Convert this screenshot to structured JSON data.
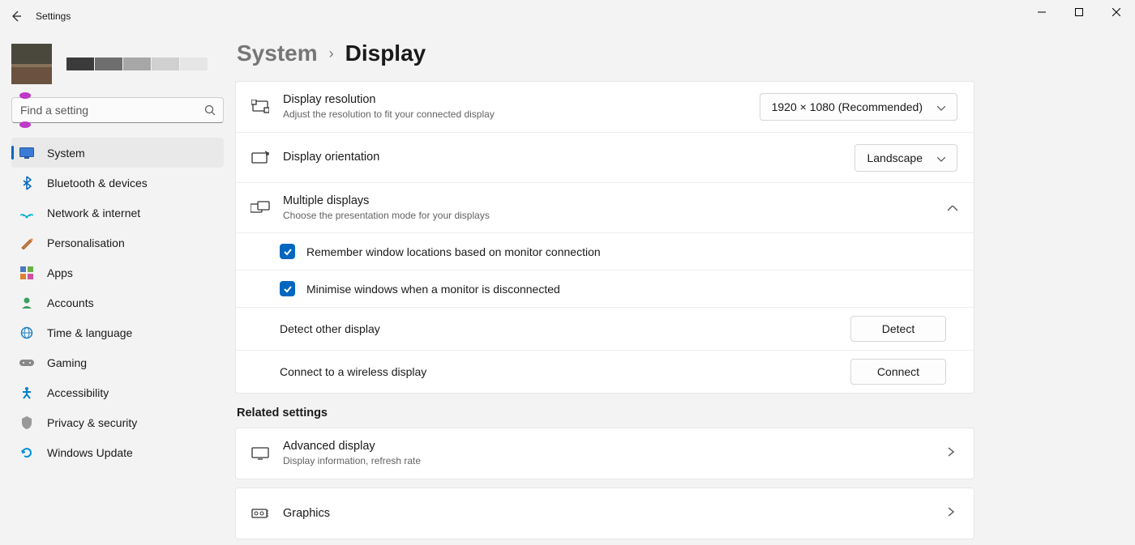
{
  "window": {
    "title": "Settings"
  },
  "search": {
    "placeholder": "Find a setting"
  },
  "nav": {
    "items": [
      {
        "label": "System"
      },
      {
        "label": "Bluetooth & devices"
      },
      {
        "label": "Network & internet"
      },
      {
        "label": "Personalisation"
      },
      {
        "label": "Apps"
      },
      {
        "label": "Accounts"
      },
      {
        "label": "Time & language"
      },
      {
        "label": "Gaming"
      },
      {
        "label": "Accessibility"
      },
      {
        "label": "Privacy & security"
      },
      {
        "label": "Windows Update"
      }
    ]
  },
  "breadcrumb": {
    "parent": "System",
    "sep": "›",
    "current": "Display"
  },
  "rows": {
    "resolution": {
      "title": "Display resolution",
      "sub": "Adjust the resolution to fit your connected display",
      "value": "1920 × 1080 (Recommended)"
    },
    "orientation": {
      "title": "Display orientation",
      "value": "Landscape"
    },
    "multi": {
      "title": "Multiple displays",
      "sub": "Choose the presentation mode for your displays",
      "opt1": "Remember window locations based on monitor connection",
      "opt2": "Minimise windows when a monitor is disconnected",
      "detect_label": "Detect other display",
      "detect_btn": "Detect",
      "connect_label": "Connect to a wireless display",
      "connect_btn": "Connect"
    }
  },
  "related": {
    "heading": "Related settings",
    "advanced": {
      "title": "Advanced display",
      "sub": "Display information, refresh rate"
    },
    "graphics": {
      "title": "Graphics"
    }
  }
}
